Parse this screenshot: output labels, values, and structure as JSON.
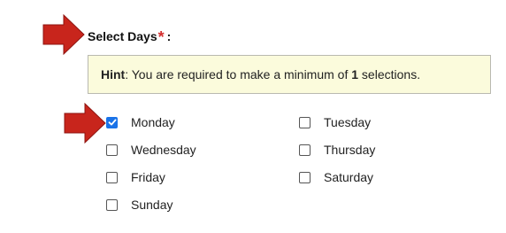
{
  "field": {
    "label": "Select Days",
    "required_mark": "*",
    "colon": ":"
  },
  "hint": {
    "prefix": "Hint",
    "text_before": ": You are required to make a minimum of ",
    "count": "1",
    "text_after": " selections."
  },
  "options": [
    {
      "label": "Monday",
      "checked": true
    },
    {
      "label": "Tuesday",
      "checked": false
    },
    {
      "label": "Wednesday",
      "checked": false
    },
    {
      "label": "Thursday",
      "checked": false
    },
    {
      "label": "Friday",
      "checked": false
    },
    {
      "label": "Saturday",
      "checked": false
    },
    {
      "label": "Sunday",
      "checked": false
    }
  ],
  "colors": {
    "arrow": "#c8251c",
    "required_star": "#d32f2f",
    "hint_background": "#fbfbdc",
    "checkbox_checked": "#1a73e8"
  },
  "icons": {
    "arrow": "right-arrow-icon",
    "check": "checkmark-icon"
  }
}
